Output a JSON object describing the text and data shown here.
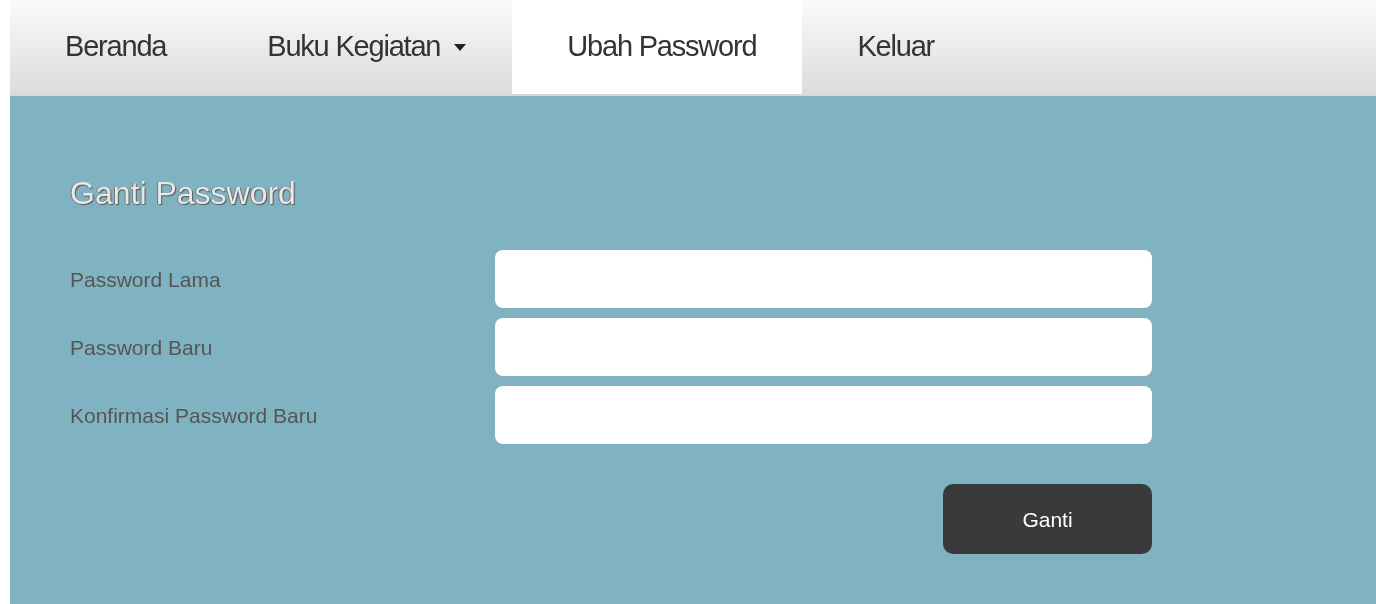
{
  "nav": {
    "items": [
      {
        "label": "Beranda",
        "kind": "link",
        "selected": false
      },
      {
        "label": "Buku Kegiatan",
        "kind": "dropdown",
        "selected": false
      },
      {
        "label": "Ubah Password",
        "kind": "link",
        "selected": true
      },
      {
        "label": "Keluar",
        "kind": "link",
        "selected": false
      }
    ]
  },
  "form": {
    "title": "Ganti Password",
    "fields": [
      {
        "label": "Password Lama"
      },
      {
        "label": "Password Baru"
      },
      {
        "label": "Konfirmasi Password Baru"
      }
    ],
    "submit": "Ganti"
  }
}
